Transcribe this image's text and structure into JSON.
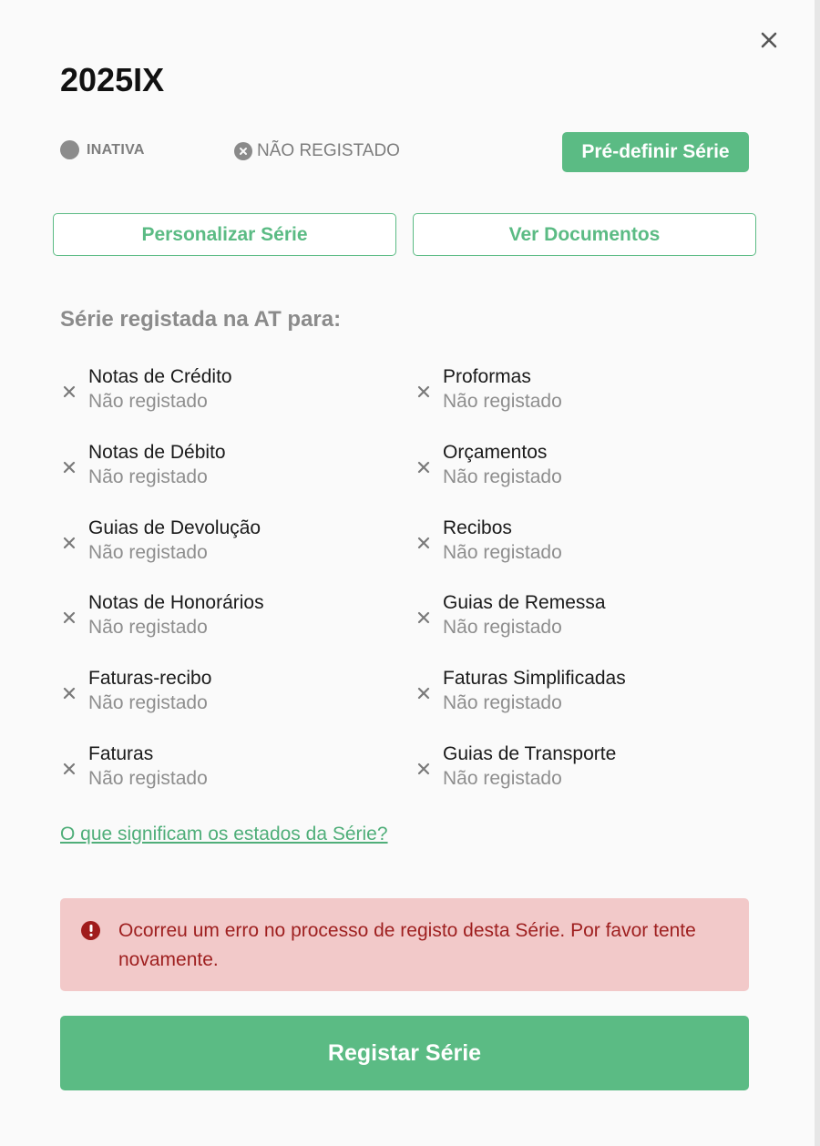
{
  "title": "2025IX",
  "status": {
    "state_label": "INATIVA",
    "registration_label": "NÃO REGISTADO"
  },
  "actions": {
    "predefine_label": "Pré-definir Série",
    "customize_label": "Personalizar Série",
    "view_docs_label": "Ver Documentos"
  },
  "section_title": "Série registada na AT para:",
  "documents": [
    {
      "name": "Notas de Crédito",
      "status": "Não registado"
    },
    {
      "name": "Proformas",
      "status": "Não registado"
    },
    {
      "name": "Notas de Débito",
      "status": "Não registado"
    },
    {
      "name": "Orçamentos",
      "status": "Não registado"
    },
    {
      "name": "Guias de Devolução",
      "status": "Não registado"
    },
    {
      "name": "Recibos",
      "status": "Não registado"
    },
    {
      "name": "Notas de Honorários",
      "status": "Não registado"
    },
    {
      "name": "Guias de Remessa",
      "status": "Não registado"
    },
    {
      "name": "Faturas-recibo",
      "status": "Não registado"
    },
    {
      "name": "Faturas Simplificadas",
      "status": "Não registado"
    },
    {
      "name": "Faturas",
      "status": "Não registado"
    },
    {
      "name": "Guias de Transporte",
      "status": "Não registado"
    }
  ],
  "help_link": "O que significam os estados da Série?",
  "error_message": "Ocorreu um erro no processo de registo desta Série. Por favor tente novamente.",
  "submit_label": "Registar Série",
  "colors": {
    "accent": "#5bbb84",
    "error_bg": "#f2c9c9",
    "error_text": "#9e1f1f",
    "muted": "#8e8e8e"
  }
}
